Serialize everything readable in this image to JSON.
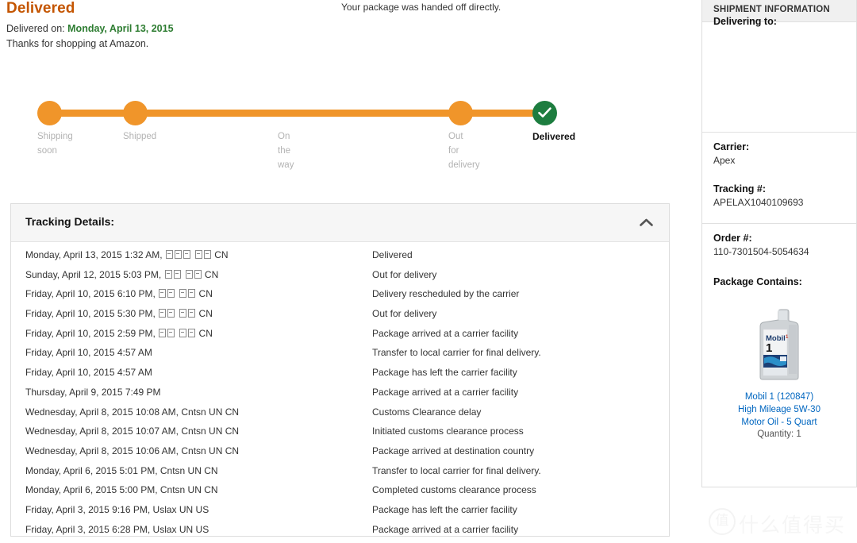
{
  "status": {
    "title": "Delivered",
    "delivered_on_label": "Delivered on:",
    "delivered_on_date": "Monday, April 13, 2015",
    "thanks": "Thanks for shopping at Amazon.",
    "handoff_note": "Your package was handed off directly."
  },
  "colors": {
    "title_orange": "#c45500",
    "track_orange": "#f0952a",
    "delivered_green": "#1d7d3f",
    "link_blue": "#0066c0"
  },
  "tracker": {
    "steps": [
      {
        "label": "Shipping\nsoon",
        "state": "done-orange",
        "dot": true
      },
      {
        "label": "Shipped",
        "state": "done-orange",
        "dot": true
      },
      {
        "label": "On\nthe\nway",
        "state": "no-dot",
        "dot": false
      },
      {
        "label": "Out\nfor\ndelivery",
        "state": "done-orange",
        "dot": true
      },
      {
        "label": "Delivered",
        "state": "complete-green",
        "dot": true
      }
    ]
  },
  "tracking_details": {
    "header": "Tracking Details:",
    "collapse_icon": "chevron-up-icon",
    "rows": [
      {
        "when": "Monday, April 13, 2015 1:32 AM, ",
        "boxes": [
          3,
          2
        ],
        "suffix": "CN",
        "what": "Delivered"
      },
      {
        "when": "Sunday, April 12, 2015 5:03 PM, ",
        "boxes": [
          2,
          2
        ],
        "suffix": "CN",
        "what": "Out for delivery"
      },
      {
        "when": "Friday, April 10, 2015 6:10 PM, ",
        "boxes": [
          2,
          2
        ],
        "suffix": "CN",
        "what": "Delivery rescheduled by the carrier"
      },
      {
        "when": "Friday, April 10, 2015 5:30 PM, ",
        "boxes": [
          2,
          2
        ],
        "suffix": "CN",
        "what": "Out for delivery"
      },
      {
        "when": "Friday, April 10, 2015 2:59 PM, ",
        "boxes": [
          2,
          2
        ],
        "suffix": "CN",
        "what": "Package arrived at a carrier facility"
      },
      {
        "when": "Friday, April 10, 2015 4:57 AM",
        "boxes": [],
        "suffix": "",
        "what": "Transfer to local carrier for final delivery."
      },
      {
        "when": "Friday, April 10, 2015 4:57 AM",
        "boxes": [],
        "suffix": "",
        "what": "Package has left the carrier facility"
      },
      {
        "when": "Thursday, April 9, 2015 7:49 PM",
        "boxes": [],
        "suffix": "",
        "what": "Package arrived at a carrier facility"
      },
      {
        "when": "Wednesday, April 8, 2015 10:08 AM, Cntsn UN CN",
        "boxes": [],
        "suffix": "",
        "what": "Customs Clearance delay"
      },
      {
        "when": "Wednesday, April 8, 2015 10:07 AM, Cntsn UN CN",
        "boxes": [],
        "suffix": "",
        "what": "Initiated customs clearance process"
      },
      {
        "when": "Wednesday, April 8, 2015 10:06 AM, Cntsn UN CN",
        "boxes": [],
        "suffix": "",
        "what": "Package arrived at destination country"
      },
      {
        "when": "Monday, April 6, 2015 5:01 PM, Cntsn UN CN",
        "boxes": [],
        "suffix": "",
        "what": "Transfer to local carrier for final delivery."
      },
      {
        "when": "Monday, April 6, 2015 5:00 PM, Cntsn UN CN",
        "boxes": [],
        "suffix": "",
        "what": "Completed customs clearance process"
      },
      {
        "when": "Friday, April 3, 2015 9:16 PM, Uslax UN US",
        "boxes": [],
        "suffix": "",
        "what": "Package has left the carrier facility"
      },
      {
        "when": "Friday, April 3, 2015 6:28 PM, Uslax UN US",
        "boxes": [],
        "suffix": "",
        "what": "Package arrived at a carrier facility"
      }
    ]
  },
  "sidebar": {
    "header": "SHIPMENT INFORMATION",
    "delivering_to_label": "Delivering to:",
    "delivering_to_value": "",
    "carrier_label": "Carrier:",
    "carrier_value": "Apex",
    "tracking_label": "Tracking #:",
    "tracking_value": "APELAX1040109693",
    "order_label": "Order #:",
    "order_value": "110-7301504-5054634",
    "contains_label": "Package Contains:",
    "product": {
      "image_name": "mobil-1-motor-oil-jug-image",
      "line1": "Mobil 1 (120847)",
      "line2": "High Mileage 5W-30",
      "line3": "Motor Oil - 5 Quart",
      "quantity": "Quantity: 1"
    }
  },
  "watermark": {
    "logo_char": "值",
    "text": "什么值得买"
  }
}
